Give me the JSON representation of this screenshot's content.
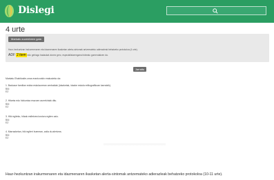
{
  "header": {
    "logo_text": "Dislegi",
    "search": {
      "placeholder": "",
      "icon": "search-icon"
    },
    "brand_color": "#2b9e62"
  },
  "page": {
    "title": "4 urte"
  },
  "panel": {
    "show_button": "Markatu zuzenbeen gaia",
    "description": "Haur-hezkuntzan inskurmenaren eta idazmenaren ikasketan alerta-sintomak antzemateko adierazleak behatzeko protokoloa (4 urte).",
    "answer_prefix": "ADI! ",
    "answer_highlight": "2 item",
    "answer_suffix": " edo gehiago badaukat zionez gero, espezialistarengana bideratu gomendatzen da."
  },
  "submit_button": "Jarraitu",
  "instructions": "Markatu Ehabitusite-zona erantzunkin erakusteko da:",
  "questions": [
    {
      "text": "1. Baduzue familian edota eskolaurrean zenbakiak (idazketak, idazke eskola erlitografikoan karratzik).",
      "yes": "BAI",
      "no": "EZ"
    },
    {
      "text": "2. Hitzeta edo hizkuntza erazoen aurrekiniak ditu.",
      "yes": "BAI",
      "no": "EZ"
    },
    {
      "text": "3. Hiki egiteko, hitzak esfietzea kosturu egiten zaio.",
      "yes": "BAI",
      "no": "EZ"
    },
    {
      "text": "4. Marrazketan, hiki egiteri buenean, zaila du alertzea.",
      "yes": "BAI",
      "no": "EZ"
    }
  ],
  "footer": {
    "text": "Haur-hezkuntzan irakurmenaren eta idazmenaren ikasketan alerta-sintomak antzemateko adierazleak behatzeko protokoloa (10-11 urte)."
  }
}
